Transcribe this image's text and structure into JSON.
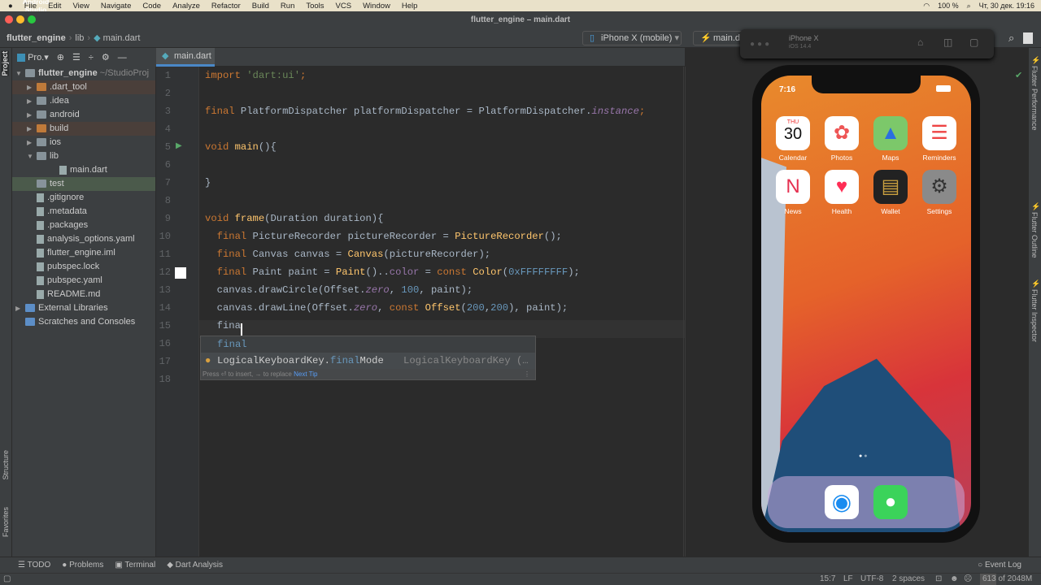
{
  "menubar": {
    "app": "Android Studio",
    "items": [
      "File",
      "Edit",
      "View",
      "Navigate",
      "Code",
      "Analyze",
      "Refactor",
      "Build",
      "Run",
      "Tools",
      "VCS",
      "Window",
      "Help"
    ],
    "battery": "100 %",
    "datetime": "Чт, 30 дек.  19:16"
  },
  "window": {
    "title": "flutter_engine – main.dart"
  },
  "nav": {
    "breadcrumb": [
      "flutter_engine",
      "lib",
      "main.dart"
    ],
    "device": "iPhone X (mobile)",
    "run_config": "main.dart"
  },
  "simulator": {
    "name": "iPhone X",
    "os": "iOS 14.4"
  },
  "project": {
    "view": "Pro.▾",
    "side_tab": "Project",
    "root": "flutter_engine",
    "root_hint": "~/StudioProj",
    "items": [
      {
        "label": ".dart_tool",
        "type": "folder-or",
        "indent": 1,
        "arrow": "▶",
        "style": "ex"
      },
      {
        "label": ".idea",
        "type": "folder",
        "indent": 1,
        "arrow": "▶"
      },
      {
        "label": "android",
        "type": "folder",
        "indent": 1,
        "arrow": "▶"
      },
      {
        "label": "build",
        "type": "folder-or",
        "indent": 1,
        "arrow": "▶",
        "style": "ex"
      },
      {
        "label": "ios",
        "type": "folder",
        "indent": 1,
        "arrow": "▶"
      },
      {
        "label": "lib",
        "type": "folder",
        "indent": 1,
        "arrow": "▼"
      },
      {
        "label": "main.dart",
        "type": "file",
        "indent": 3,
        "arrow": ""
      },
      {
        "label": "test",
        "type": "folder",
        "indent": 1,
        "arrow": "",
        "style": "sel"
      },
      {
        "label": ".gitignore",
        "type": "file",
        "indent": 1,
        "arrow": ""
      },
      {
        "label": ".metadata",
        "type": "file",
        "indent": 1,
        "arrow": ""
      },
      {
        "label": ".packages",
        "type": "file",
        "indent": 1,
        "arrow": ""
      },
      {
        "label": "analysis_options.yaml",
        "type": "file",
        "indent": 1,
        "arrow": ""
      },
      {
        "label": "flutter_engine.iml",
        "type": "file",
        "indent": 1,
        "arrow": ""
      },
      {
        "label": "pubspec.lock",
        "type": "file",
        "indent": 1,
        "arrow": ""
      },
      {
        "label": "pubspec.yaml",
        "type": "file",
        "indent": 1,
        "arrow": ""
      },
      {
        "label": "README.md",
        "type": "file",
        "indent": 1,
        "arrow": ""
      },
      {
        "label": "External Libraries",
        "type": "folder-bl",
        "indent": 0,
        "arrow": "▶"
      },
      {
        "label": "Scratches and Consoles",
        "type": "folder-bl",
        "indent": 0,
        "arrow": ""
      }
    ]
  },
  "left_strip": {
    "structure": "Structure",
    "favorites": "Favorites"
  },
  "editor": {
    "tab": "main.dart",
    "lines": [
      [
        [
          "import ",
          "k"
        ],
        [
          "'dart:ui'",
          "s"
        ],
        [
          ";",
          "c"
        ]
      ],
      [],
      [
        [
          "final ",
          "k"
        ],
        [
          "PlatformDispatcher platformDispatcher = PlatformDispatcher.",
          ""
        ],
        [
          "instance",
          "i"
        ],
        [
          ";",
          "c"
        ]
      ],
      [],
      [
        [
          "void ",
          "k"
        ],
        [
          "main",
          "f"
        ],
        [
          "(){",
          ""
        ]
      ],
      [],
      [
        [
          "}",
          ""
        ]
      ],
      [],
      [
        [
          "void ",
          "k"
        ],
        [
          "frame",
          "f"
        ],
        [
          "(Duration duration){",
          ""
        ]
      ],
      [
        [
          "  final ",
          "k"
        ],
        [
          "PictureRecorder pictureRecorder = ",
          ""
        ],
        [
          "PictureRecorder",
          "f"
        ],
        [
          "();",
          ""
        ]
      ],
      [
        [
          "  final ",
          "k"
        ],
        [
          "Canvas canvas = ",
          ""
        ],
        [
          "Canvas",
          "f"
        ],
        [
          "(pictureRecorder);",
          ""
        ]
      ],
      [
        [
          "  final ",
          "k"
        ],
        [
          "Paint paint = ",
          ""
        ],
        [
          "Paint",
          "f"
        ],
        [
          "()..",
          ""
        ],
        [
          "color",
          "p"
        ],
        [
          " = ",
          ""
        ],
        [
          "const ",
          "k"
        ],
        [
          "Color",
          "f"
        ],
        [
          "(",
          ""
        ],
        [
          "0xFFFFFFFF",
          "n"
        ],
        [
          ");",
          ""
        ]
      ],
      [
        [
          "  canvas.drawCircle(Offset.",
          ""
        ],
        [
          "zero",
          "i"
        ],
        [
          ", ",
          ""
        ],
        [
          "100",
          "n"
        ],
        [
          ", paint);",
          ""
        ]
      ],
      [
        [
          "  canvas.drawLine(Offset.",
          ""
        ],
        [
          "zero",
          "i"
        ],
        [
          ", ",
          ""
        ],
        [
          "const ",
          "k"
        ],
        [
          "Offset",
          "f"
        ],
        [
          "(",
          ""
        ],
        [
          "200",
          "n"
        ],
        [
          ",",
          ""
        ],
        [
          "200",
          "n"
        ],
        [
          "), paint);",
          ""
        ]
      ],
      [
        [
          "  fina",
          ""
        ]
      ],
      [],
      [],
      []
    ]
  },
  "completion": {
    "typed": "final",
    "item_prefix": "LogicalKeyboardKey.",
    "item_match": "final",
    "item_rest": "Mode",
    "item_type": "LogicalKeyboardKey (…",
    "footer": "Press ⏎ to insert, → to replace",
    "next_tip": "Next Tip"
  },
  "phone": {
    "time": "7:16",
    "calendar_day": "THU",
    "calendar_date": "30",
    "apps": [
      "Calendar",
      "Photos",
      "Maps",
      "Reminders",
      "News",
      "Health",
      "Wallet",
      "Settings"
    ]
  },
  "right_strip": [
    "Flutter Performance",
    "Flutter Outline",
    "Flutter Inspector"
  ],
  "bottom_tools": [
    "TODO",
    "Problems",
    "Terminal",
    "Dart Analysis"
  ],
  "event_log": "Event Log",
  "status": {
    "position": "15:7",
    "line_sep": "LF",
    "encoding": "UTF-8",
    "indent": "2 spaces",
    "memory": "613 of 2048M"
  }
}
